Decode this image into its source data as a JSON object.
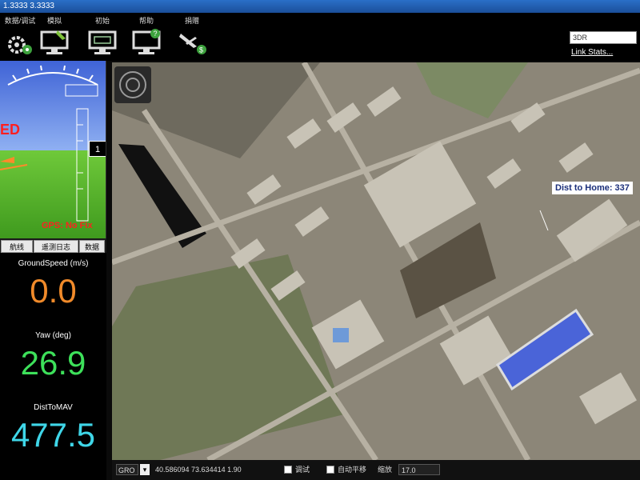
{
  "window": {
    "title": "1.3333 3.3333"
  },
  "toolbar": {
    "items": [
      {
        "label": "数据/调试",
        "icon": "gear-icon"
      },
      {
        "label": "模拟",
        "icon": "monitor-plane-icon"
      },
      {
        "label": "初始",
        "icon": "monitor-config-icon"
      },
      {
        "label": "帮助",
        "icon": "monitor-help-icon"
      },
      {
        "label": "捐赠",
        "icon": "plane-donate-icon"
      }
    ],
    "connection_value": "3DR",
    "link_stats": "Link Stats..."
  },
  "hud": {
    "mode_text": "ED",
    "gps_status": "GPS: No Fix",
    "altitude": "1",
    "colors": {
      "sky": "#5b7fe8",
      "ground": "#58b52c",
      "warning": "#ff2020"
    }
  },
  "tabs": [
    "航线",
    "遥测日志",
    "数据"
  ],
  "quick": {
    "ground_speed_label": "GroundSpeed (m/s)",
    "ground_speed_value": "0.0",
    "yaw_label": "Yaw (deg)",
    "yaw_value": "26.9",
    "dist_label": "DistToMAV",
    "dist_value": "477.5",
    "colors": {
      "ground_speed": "#f08a2a",
      "yaw": "#3de05a",
      "dist": "#3fd6e8"
    }
  },
  "map": {
    "dist_to_home": "Dist to Home: 337"
  },
  "statusbar": {
    "source": "GRO",
    "coords": "40.586094  73.634414  1.90",
    "debug_label": "调试",
    "auto_pan_label": "自动平移",
    "zoom_label": "缩放",
    "zoom_value": "17.0"
  }
}
